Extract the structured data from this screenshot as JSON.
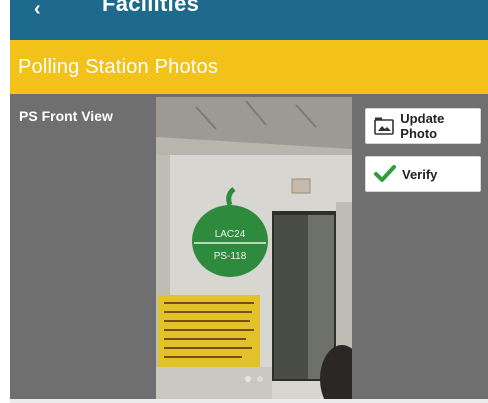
{
  "header": {
    "title": "Facilities",
    "back_icon": "back-arrow-icon",
    "background": "#1e6a8d"
  },
  "section": {
    "title": "Polling Station Photos",
    "background": "#f2c21a"
  },
  "photo_panel": {
    "label": "PS Front View",
    "background": "#6f6f6f",
    "photo_text": {
      "line1": "LAC24",
      "line2": "PS-118"
    },
    "carousel": {
      "count": 2,
      "active_index": 0
    }
  },
  "actions": {
    "update_photo": {
      "label": "Update Photo",
      "icon": "photo-icon"
    },
    "verify": {
      "label": "Verify",
      "icon": "checkmark-icon",
      "icon_color": "#2e9e3c"
    }
  }
}
